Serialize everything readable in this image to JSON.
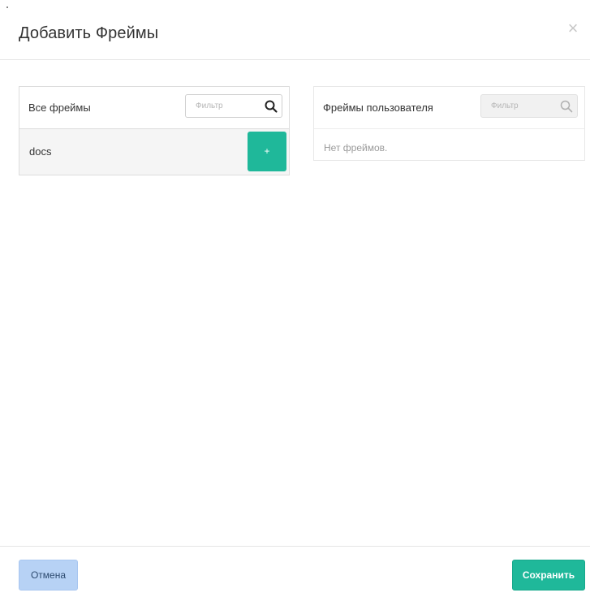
{
  "dialog": {
    "title": "Добавить Фреймы",
    "close_icon": "close-icon"
  },
  "left_panel": {
    "title": "Все фреймы",
    "filter_placeholder": "Фильтр",
    "filter_icon": "search-icon",
    "items": [
      {
        "label": "docs",
        "action_label": "+"
      }
    ]
  },
  "right_panel": {
    "title": "Фреймы пользователя",
    "filter_placeholder": "Фильтр",
    "filter_icon": "search-icon",
    "empty_text": "Нет фреймов."
  },
  "footer": {
    "cancel_label": "Отмена",
    "save_label": "Сохранить"
  },
  "colors": {
    "accent": "#1fb89a",
    "cancel_bg": "#b7d2f5"
  }
}
